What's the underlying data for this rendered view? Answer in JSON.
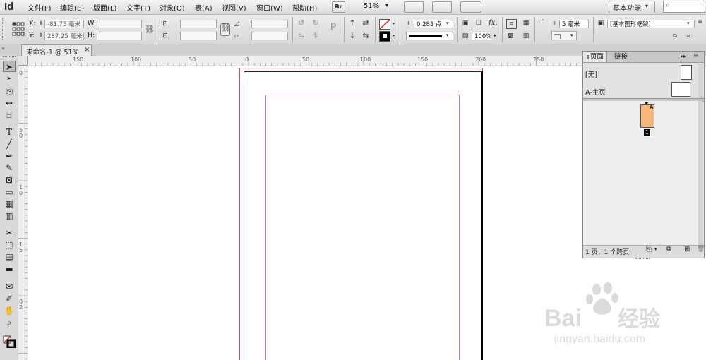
{
  "app": {
    "logo": "Id"
  },
  "menu": {
    "items": [
      "文件(F)",
      "编辑(E)",
      "版面(L)",
      "文字(T)",
      "对象(O)",
      "表(A)",
      "视图(V)",
      "窗口(W)",
      "帮助(H)"
    ],
    "bridge_label": "Br",
    "zoom": "51%",
    "workspace": "基本功能",
    "search_placeholder": ""
  },
  "control": {
    "x_label": "X:",
    "y_label": "Y:",
    "w_label": "W:",
    "h_label": "H:",
    "x_value": "-81.75 毫米",
    "y_value": "287.25 毫米",
    "stroke_weight": "0.283 点",
    "opacity": "100%",
    "corner_size": "5 毫米",
    "object_style": "[基本图形框架]"
  },
  "tab": {
    "title": "未命名-1 @ 51%",
    "close": "×"
  },
  "ruler": {
    "h_labels": [
      "150",
      "100",
      "50",
      "0",
      "50",
      "100",
      "150",
      "200",
      "250"
    ],
    "v_labels": [
      "0",
      "5",
      "0",
      "1",
      "0",
      "1",
      "5",
      "0",
      "2"
    ]
  },
  "pages_panel": {
    "tab_pages": "页面",
    "tab_links": "链接",
    "master_none": "[无]",
    "master_a": "A-主页",
    "page_master_letter": "A",
    "page_number": "1",
    "status": "1 页，1 个跨页"
  },
  "colors": {
    "bleed": "#e8455a",
    "margin": "#b57bd6",
    "page_thumb": "#f7b77a"
  }
}
